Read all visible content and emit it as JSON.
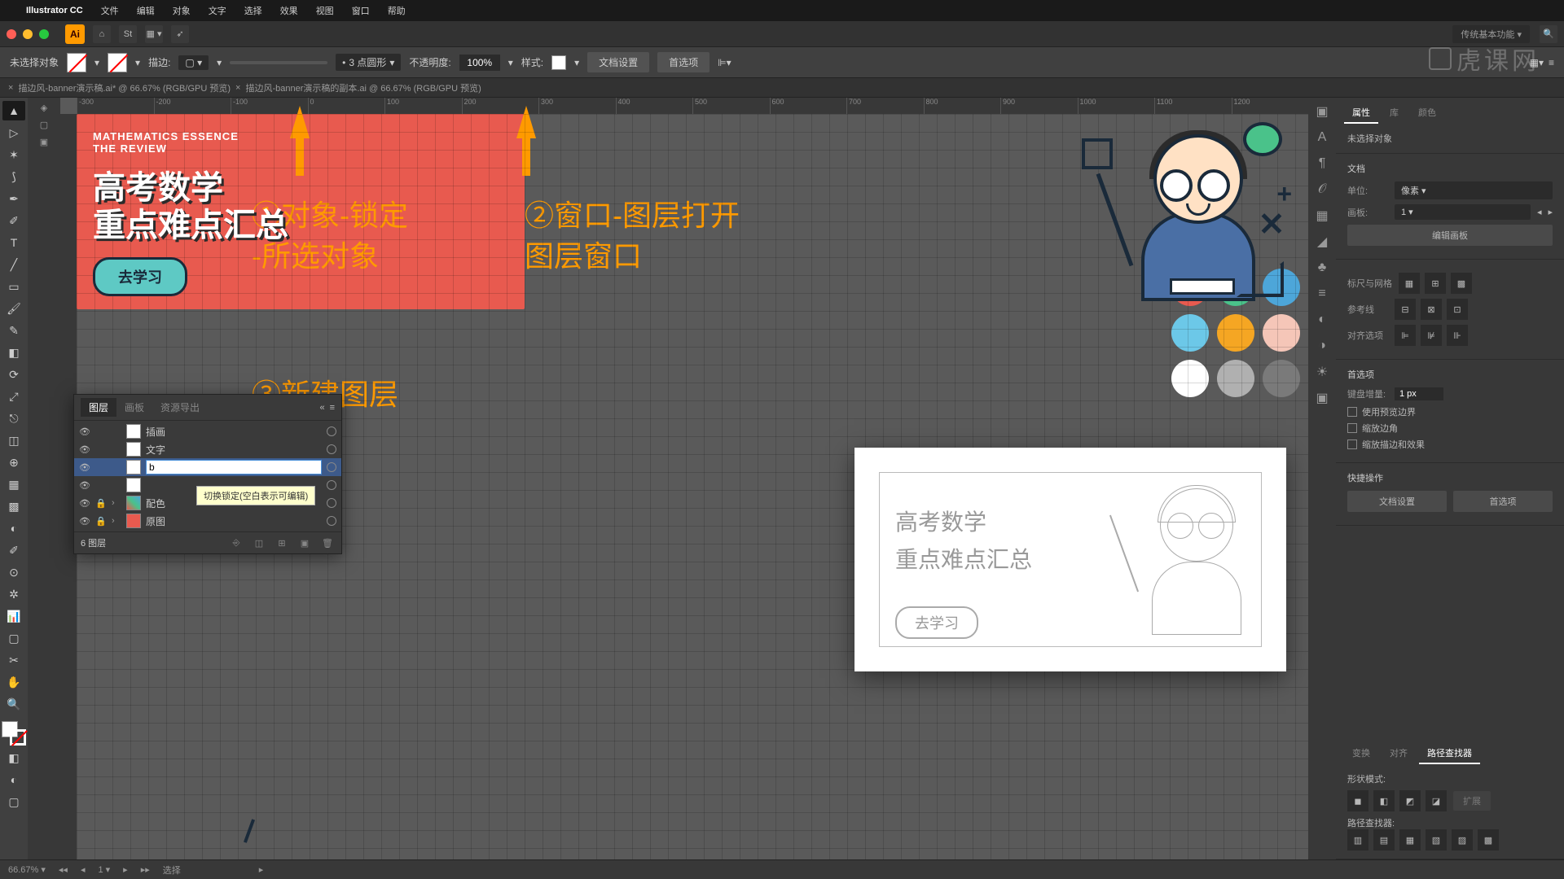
{
  "menubar": {
    "app": "Illustrator CC",
    "items": [
      "文件",
      "编辑",
      "对象",
      "文字",
      "选择",
      "效果",
      "视图",
      "窗口",
      "帮助"
    ]
  },
  "secbar": {
    "ai": "Ai",
    "st": "St",
    "workspace": "传统基本功能"
  },
  "ctrl": {
    "noSel": "未选择对象",
    "stroke": "描边:",
    "shape": "3 点圆形",
    "opacityLbl": "不透明度:",
    "opacity": "100%",
    "styleLbl": "样式:",
    "doc": "文档设置",
    "pref": "首选项"
  },
  "tabs": {
    "t1": "描边风-banner演示稿.ai* @ 66.67% (RGB/GPU 预览)",
    "t2": "描边风-banner演示稿的副本.ai @ 66.67% (RGB/GPU 预览)"
  },
  "anno": {
    "a1l1": "①对象-锁定",
    "a1l2": "-所选对象",
    "a2l1": "②窗口-图层打开",
    "a2l2": "图层窗口",
    "a3": "③新建图层"
  },
  "ruler": [
    "-300",
    "-200",
    "-100",
    "0",
    "100",
    "200",
    "300",
    "400",
    "500",
    "600",
    "700",
    "800",
    "900",
    "1000",
    "1100",
    "1200"
  ],
  "palette": [
    "#e85a4f",
    "#4ac28a",
    "#4da6d9",
    "#6cc8e8",
    "#f5a623",
    "#f5c6b8",
    "#ffffff",
    "#b0b0b0",
    "#7a7a7a"
  ],
  "ab1": {
    "sub1": "MATHEMATICS ESSENCE",
    "sub2": "THE REVIEW",
    "t1": "高考数学",
    "t2": "重点难点汇总",
    "btn": "去学习"
  },
  "ab2": {
    "t1": "高考数学",
    "t2": "重点难点汇总",
    "btn": "去学习"
  },
  "layers": {
    "tabs": [
      "图层",
      "画板",
      "资源导出"
    ],
    "items": [
      {
        "name": "插画"
      },
      {
        "name": "文字"
      },
      {
        "name": "b",
        "editing": true
      },
      {
        "name": ""
      },
      {
        "name": "配色"
      },
      {
        "name": "原图"
      }
    ],
    "tooltip": "切换锁定(空白表示可编辑)",
    "count": "6 图层"
  },
  "props": {
    "tabs": [
      "属性",
      "库",
      "颜色"
    ],
    "noSel": "未选择对象",
    "doc": "文档",
    "unitsLbl": "单位:",
    "units": "像素",
    "artboardLbl": "画板:",
    "artboard": "1",
    "editAb": "编辑画板",
    "rulerGrid": "标尺与网格",
    "guides": "参考线",
    "alignOpts": "对齐选项",
    "prefs": "首选项",
    "kbIncLbl": "键盘增量:",
    "kbInc": "1 px",
    "usePrev": "使用预览边界",
    "scaleCorner": "缩放边角",
    "scaleStroke": "缩放描边和效果",
    "quick": "快捷操作",
    "docSet": "文档设置",
    "pref": "首选项"
  },
  "pfind": {
    "tabs": [
      "变换",
      "对齐",
      "路径查找器"
    ],
    "shape": "形状模式:",
    "expand": "扩展",
    "pf": "路径查找器:"
  },
  "status": {
    "zoom": "66.67%",
    "sel": "选择"
  },
  "watermark": "虎课网"
}
